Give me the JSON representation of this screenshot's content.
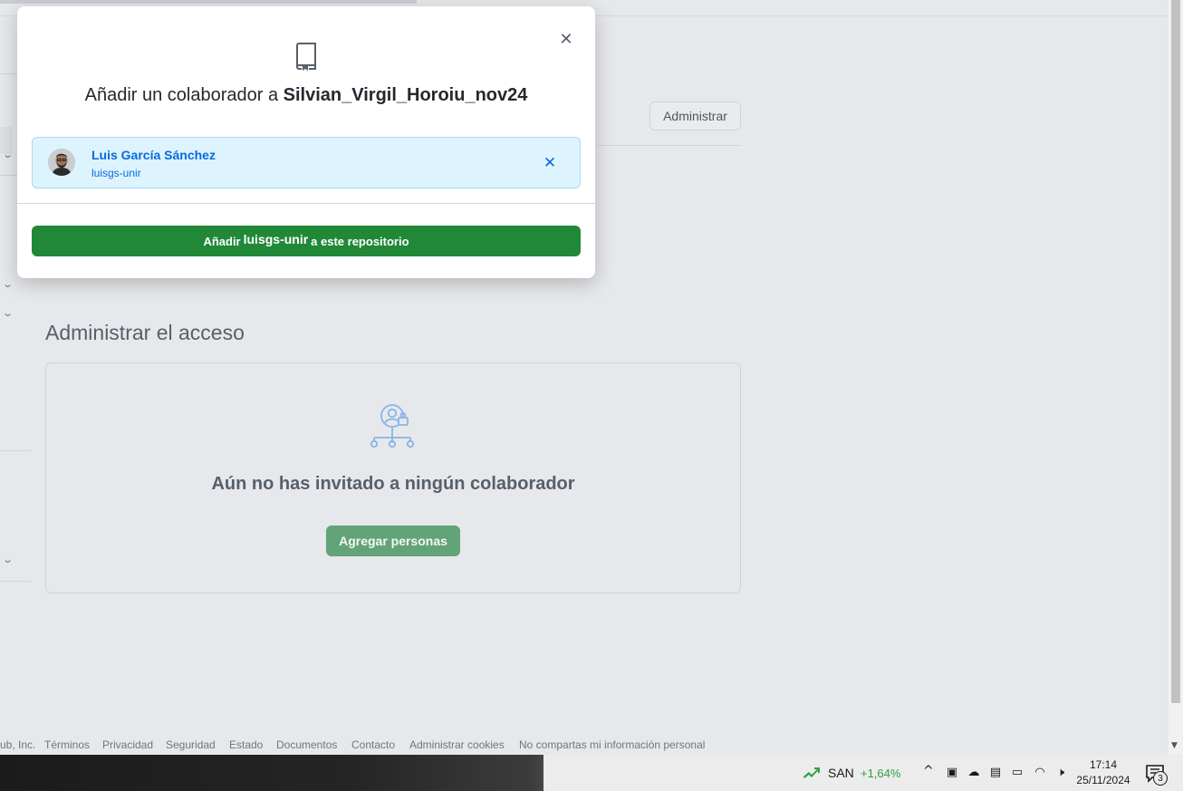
{
  "modal": {
    "title_prefix": "Añadir un colaborador a",
    "repo_name": "Silvian_Virgil_Horoiu_nov24",
    "close_icon": "close-icon",
    "repo_icon": "repo-icon",
    "selected_user": {
      "name": "Luis García Sánchez",
      "login": "luisgs-unir"
    },
    "add_button": {
      "prefix": "Añadir",
      "user": "luisgs-unir",
      "suffix": "a este repositorio"
    }
  },
  "page": {
    "admin_button": "Administrar",
    "access_title": "Administrar el acceso",
    "empty_message": "Aún no has invitado a ningún colaborador",
    "add_people_button": "Agregar personas"
  },
  "footer": {
    "links": [
      "ub, Inc.",
      "Términos",
      "Privacidad",
      "Seguridad",
      "Estado",
      "Documentos",
      "Contacto",
      "Administrar cookies",
      "No compartas mi información personal"
    ]
  },
  "taskbar": {
    "stock_name": "SAN",
    "stock_change": "+1,64%",
    "time": "17:14",
    "date": "25/11/2024",
    "notifications": "3"
  },
  "colors": {
    "primary_button": "#218838",
    "link": "#0969da",
    "selected_user_bg": "#ddf4ff"
  }
}
